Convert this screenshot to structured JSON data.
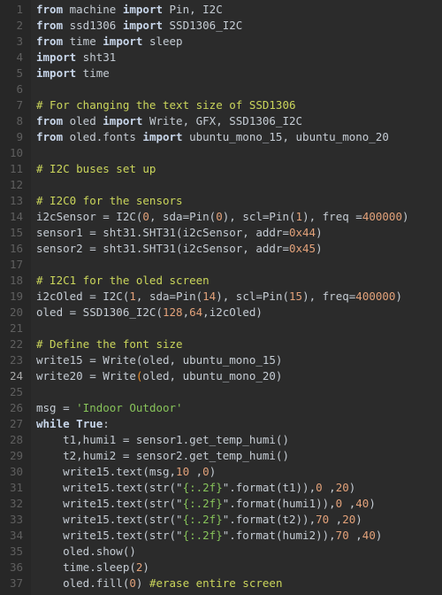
{
  "editor": {
    "current_line": 24,
    "colors": {
      "background": "#2b2b2b",
      "keyword": "#c8d6ea",
      "number": "#e3a27a",
      "comment": "#cbd65b",
      "string": "#87c35a",
      "text": "#c5ccd4"
    },
    "lines": [
      [
        [
          "kw",
          "from"
        ],
        [
          "id",
          " machine "
        ],
        [
          "kw",
          "import"
        ],
        [
          "id",
          " Pin, I2C"
        ]
      ],
      [
        [
          "kw",
          "from"
        ],
        [
          "id",
          " ssd1306 "
        ],
        [
          "kw",
          "import"
        ],
        [
          "id",
          " SSD1306_I2C"
        ]
      ],
      [
        [
          "kw",
          "from"
        ],
        [
          "id",
          " time "
        ],
        [
          "kw",
          "import"
        ],
        [
          "id",
          " sleep"
        ]
      ],
      [
        [
          "kw",
          "import"
        ],
        [
          "id",
          " sht31"
        ]
      ],
      [
        [
          "kw",
          "import"
        ],
        [
          "id",
          " time"
        ]
      ],
      [],
      [
        [
          "com",
          "# For changing the text size of SSD1306"
        ]
      ],
      [
        [
          "kw",
          "from"
        ],
        [
          "id",
          " oled "
        ],
        [
          "kw",
          "import"
        ],
        [
          "id",
          " Write, GFX, SSD1306_I2C"
        ]
      ],
      [
        [
          "kw",
          "from"
        ],
        [
          "id",
          " oled.fonts "
        ],
        [
          "kw",
          "import"
        ],
        [
          "id",
          " ubuntu_mono_15, ubuntu_mono_20"
        ]
      ],
      [],
      [
        [
          "com",
          "# I2C buses set up"
        ]
      ],
      [],
      [
        [
          "com",
          "# I2C0 for the sensors"
        ]
      ],
      [
        [
          "id",
          "i2cSensor = I2C("
        ],
        [
          "num",
          "0"
        ],
        [
          "id",
          ", sda=Pin("
        ],
        [
          "num",
          "0"
        ],
        [
          "id",
          "), scl=Pin("
        ],
        [
          "num",
          "1"
        ],
        [
          "id",
          "), freq ="
        ],
        [
          "num",
          "400000"
        ],
        [
          "id",
          ")"
        ]
      ],
      [
        [
          "id",
          "sensor1 = sht31.SHT31(i2cSensor, addr="
        ],
        [
          "num",
          "0x44"
        ],
        [
          "id",
          ")"
        ]
      ],
      [
        [
          "id",
          "sensor2 = sht31.SHT31(i2cSensor, addr="
        ],
        [
          "num",
          "0x45"
        ],
        [
          "id",
          ")"
        ]
      ],
      [],
      [
        [
          "com",
          "# I2C1 for the oled screen"
        ]
      ],
      [
        [
          "id",
          "i2cOled = I2C("
        ],
        [
          "num",
          "1"
        ],
        [
          "id",
          ", sda=Pin("
        ],
        [
          "num",
          "14"
        ],
        [
          "id",
          "), scl=Pin("
        ],
        [
          "num",
          "15"
        ],
        [
          "id",
          "), freq="
        ],
        [
          "num",
          "400000"
        ],
        [
          "id",
          ")"
        ]
      ],
      [
        [
          "id",
          "oled = SSD1306_I2C("
        ],
        [
          "num",
          "128"
        ],
        [
          "id",
          ","
        ],
        [
          "num",
          "64"
        ],
        [
          "id",
          ",i2cOled)"
        ]
      ],
      [],
      [
        [
          "com",
          "# Define the font size"
        ]
      ],
      [
        [
          "id",
          "write15 = Write(oled, ubuntu_mono_15)"
        ]
      ],
      [
        [
          "id",
          "write20 = Write"
        ],
        [
          "br",
          "("
        ],
        [
          "id",
          "oled, ubuntu_mono_20)"
        ]
      ],
      [],
      [
        [
          "id",
          "msg = "
        ],
        [
          "str",
          "'Indoor Outdoor'"
        ]
      ],
      [
        [
          "kw",
          "while"
        ],
        [
          "id",
          " "
        ],
        [
          "kw",
          "True"
        ],
        [
          "id",
          ":"
        ]
      ],
      [
        [
          "id",
          "    t1,humi1 = sensor1.get_temp_humi()"
        ]
      ],
      [
        [
          "id",
          "    t2,humi2 = sensor2.get_temp_humi()"
        ]
      ],
      [
        [
          "id",
          "    write15.text(msg,"
        ],
        [
          "num",
          "10"
        ],
        [
          "id",
          " ,"
        ],
        [
          "num",
          "0"
        ],
        [
          "id",
          ")"
        ]
      ],
      [
        [
          "id",
          "    write15.text(str(\""
        ],
        [
          "str",
          "{:.2f}"
        ],
        [
          "id",
          "\".format(t1)),"
        ],
        [
          "num",
          "0"
        ],
        [
          "id",
          " ,"
        ],
        [
          "num",
          "20"
        ],
        [
          "id",
          ")"
        ]
      ],
      [
        [
          "id",
          "    write15.text(str(\""
        ],
        [
          "str",
          "{:.2f}"
        ],
        [
          "id",
          "\".format(humi1)),"
        ],
        [
          "num",
          "0"
        ],
        [
          "id",
          " ,"
        ],
        [
          "num",
          "40"
        ],
        [
          "id",
          ")"
        ]
      ],
      [
        [
          "id",
          "    write15.text(str(\""
        ],
        [
          "str",
          "{:.2f}"
        ],
        [
          "id",
          "\".format(t2)),"
        ],
        [
          "num",
          "70"
        ],
        [
          "id",
          " ,"
        ],
        [
          "num",
          "20"
        ],
        [
          "id",
          ")"
        ]
      ],
      [
        [
          "id",
          "    write15.text(str(\""
        ],
        [
          "str",
          "{:.2f}"
        ],
        [
          "id",
          "\".format(humi2)),"
        ],
        [
          "num",
          "70"
        ],
        [
          "id",
          " ,"
        ],
        [
          "num",
          "40"
        ],
        [
          "id",
          ")"
        ]
      ],
      [
        [
          "id",
          "    oled.show()"
        ]
      ],
      [
        [
          "id",
          "    time.sleep("
        ],
        [
          "num",
          "2"
        ],
        [
          "id",
          ")"
        ]
      ],
      [
        [
          "id",
          "    oled.fill("
        ],
        [
          "num",
          "0"
        ],
        [
          "id",
          ") "
        ],
        [
          "com",
          "#erase entire screen"
        ]
      ]
    ]
  }
}
